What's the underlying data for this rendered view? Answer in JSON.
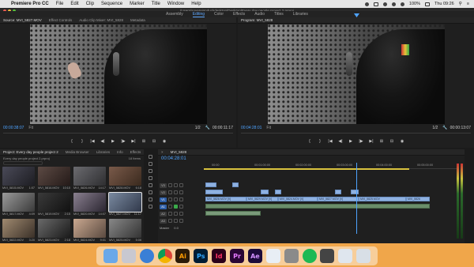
{
  "menubar": {
    "app": "Premiere Pro CC",
    "items": [
      "File",
      "Edit",
      "Clip",
      "Sequence",
      "Marker",
      "Title",
      "Window",
      "Help"
    ],
    "battery": "100%",
    "clock": "Thu 09:26"
  },
  "window": {
    "path": "/Users/sovereignduckdesktop/Desktop/Every day people project 2.prproj"
  },
  "workspaces": [
    "Assembly",
    "Editing",
    "Color",
    "Effects",
    "Audio",
    "Titles",
    "Libraries"
  ],
  "active_workspace": "Editing",
  "source": {
    "tabs": [
      "Source: MVI_5827.MOV",
      "Effect Controls",
      "Audio Clip Mixer: MVI_5828",
      "Metadata"
    ],
    "timecode": "00:00:38:07",
    "fit": "Fit",
    "resolution": "1/2",
    "duration": "00:00:11:17"
  },
  "program": {
    "tabs": [
      "Program: MVI_5828"
    ],
    "timecode": "00:04:28:01",
    "fit": "Fit",
    "resolution": "1/2",
    "duration": "00:00:13:07"
  },
  "project": {
    "tabs": [
      "Project: Every day people project 2",
      "Media Browser",
      "Libraries",
      "Info",
      "Effects"
    ],
    "path": "Every day people project 2.prproj",
    "count": "18 Items",
    "clips": [
      {
        "name": "MVI_5815.MOV",
        "dur": "1:07"
      },
      {
        "name": "MVI_5816.MOV",
        "dur": "10:10"
      },
      {
        "name": "MVI_5826.MOV",
        "dur": "14:17"
      },
      {
        "name": "MVI_5828.MOV",
        "dur": "6:18"
      },
      {
        "name": "MVI_5817.MOV",
        "dur": "4:09"
      },
      {
        "name": "MVI_5819.MOV",
        "dur": "2:15"
      },
      {
        "name": "MVI_5820.MOV",
        "dur": "14:07"
      },
      {
        "name": "MVI_5827.MOV",
        "dur": "11:17"
      },
      {
        "name": "MVI_5822.MOV",
        "dur": "3:20"
      },
      {
        "name": "MVI_5823.MOV",
        "dur": "2:18"
      },
      {
        "name": "MVI_5824.MOV",
        "dur": "9:01"
      },
      {
        "name": "MVI_5825.MOV",
        "dur": "5:06"
      }
    ]
  },
  "timeline": {
    "tab": "MVI_5828",
    "timecode": "00:04:28:01",
    "ticks": [
      "00:00",
      "00:01:00:00",
      "00:02:00:00",
      "00:03:00:00",
      "00:04:00:00",
      "00:05:00:00"
    ],
    "tracks": [
      "V3",
      "V2",
      "V1",
      "A1",
      "A2",
      "A3",
      "Master"
    ],
    "master_value": "0.0",
    "clip_labels": [
      "MVI_5828.MOV [V]",
      "MVI_5829.MOV [V]",
      "MVI_5824.MOV [V]",
      "MVI_5827.MOV [V]",
      "MVI_5825.MOV",
      "MVI_5826"
    ]
  },
  "dock": {
    "apps": [
      {
        "name": "finder",
        "label": "",
        "bg": "#6aa8e8"
      },
      {
        "name": "launchpad",
        "label": "",
        "bg": "#c8c8d0"
      },
      {
        "name": "safari",
        "label": "",
        "bg": "#3a7fd6"
      },
      {
        "name": "chrome",
        "label": "",
        "bg": "#ffffff"
      },
      {
        "name": "illustrator",
        "label": "Ai",
        "bg": "#2b1a07",
        "fg": "#ff9a00"
      },
      {
        "name": "photoshop",
        "label": "Ps",
        "bg": "#001d34",
        "fg": "#31a8ff"
      },
      {
        "name": "indesign",
        "label": "Id",
        "bg": "#2b0019",
        "fg": "#ff3366"
      },
      {
        "name": "premiere",
        "label": "Pr",
        "bg": "#2a0634",
        "fg": "#e77bff"
      },
      {
        "name": "after-effects",
        "label": "Ae",
        "bg": "#1b0b3a",
        "fg": "#d291ff"
      },
      {
        "name": "preview",
        "label": "",
        "bg": "#e8eef5"
      },
      {
        "name": "system-preferences",
        "label": "",
        "bg": "#8a8a8a"
      },
      {
        "name": "spotify",
        "label": "",
        "bg": "#1db954"
      },
      {
        "name": "photo-viewer",
        "label": "",
        "bg": "#444444"
      },
      {
        "name": "documents",
        "label": "",
        "bg": "#dfe6ee"
      },
      {
        "name": "trash",
        "label": "",
        "bg": "#d8dfe6"
      }
    ]
  }
}
